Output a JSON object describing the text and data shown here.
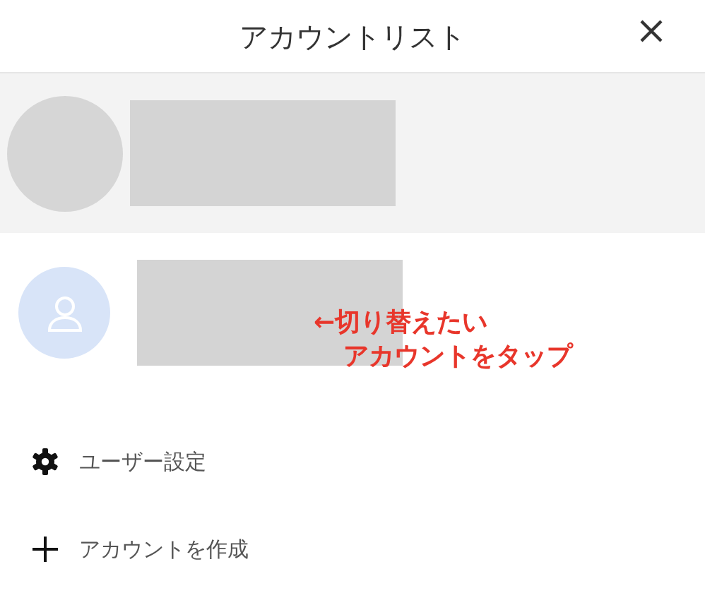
{
  "header": {
    "title": "アカウントリスト"
  },
  "accounts": [
    {
      "selected": true,
      "kind": "blank"
    },
    {
      "selected": false,
      "kind": "default"
    }
  ],
  "annotation": {
    "lines": [
      "←切り替えたい",
      "アカウントをタップ"
    ],
    "color": "#e8362b"
  },
  "menu": [
    {
      "kind": "settings",
      "label": "ユーザー設定"
    },
    {
      "kind": "add",
      "label": "アカウントを作成"
    }
  ]
}
